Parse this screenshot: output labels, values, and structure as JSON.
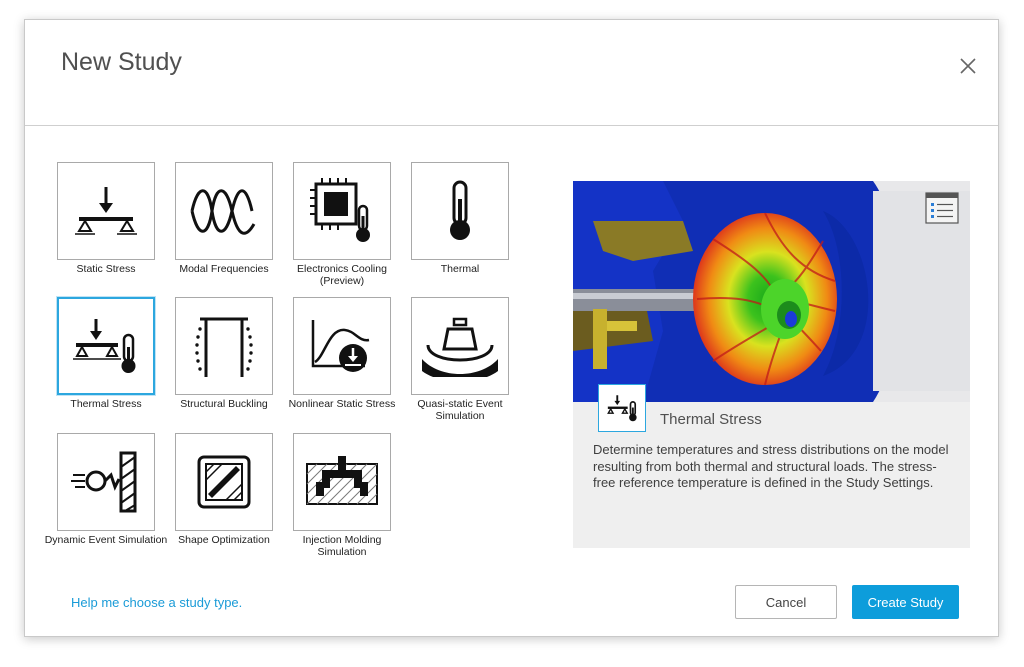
{
  "dialog": {
    "title": "New Study",
    "close_icon": "close-icon"
  },
  "study_types": [
    {
      "label": "Static Stress",
      "icon": "static-stress-icon"
    },
    {
      "label": "Modal Frequencies",
      "icon": "modal-frequencies-icon"
    },
    {
      "label": "Electronics Cooling (Preview)",
      "icon": "electronics-cooling-icon"
    },
    {
      "label": "Thermal",
      "icon": "thermometer-icon"
    },
    {
      "label": "Thermal Stress",
      "icon": "thermal-stress-icon",
      "selected": true
    },
    {
      "label": "Structural Buckling",
      "icon": "structural-buckling-icon"
    },
    {
      "label": "Nonlinear Static Stress",
      "icon": "nonlinear-static-stress-icon"
    },
    {
      "label": "Quasi-static Event Simulation",
      "icon": "quasi-static-event-icon"
    },
    {
      "label": "Dynamic Event Simulation",
      "icon": "dynamic-event-icon"
    },
    {
      "label": "Shape Optimization",
      "icon": "shape-optimization-icon"
    },
    {
      "label": "Injection Molding Simulation",
      "icon": "injection-molding-icon"
    }
  ],
  "preview": {
    "title": "Thermal Stress",
    "description": "Determine temperatures and stress distributions on the model resulting from both thermal and structural loads. The stress-free reference temperature is defined in the Study Settings.",
    "image": "turbine-stress-render",
    "badge_icon": "details-list-icon"
  },
  "footer": {
    "help_link": "Help me choose a study type.",
    "cancel_label": "Cancel",
    "create_label": "Create Study"
  },
  "colors": {
    "accent": "#0d9ddb",
    "selection_border": "#2ca7df",
    "link": "#1a9bd7",
    "preview_bg": "#efefef"
  }
}
